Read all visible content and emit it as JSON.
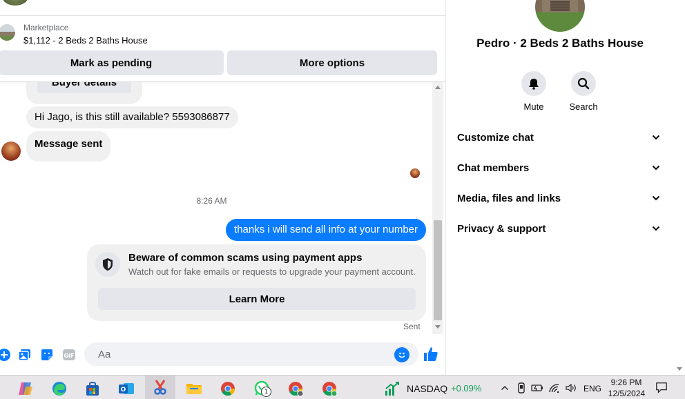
{
  "marketplace": {
    "label": "Marketplace",
    "listing": "$1,112 - 2 Beds 2 Baths House",
    "mark_pending": "Mark as pending",
    "more_options": "More options"
  },
  "messages": {
    "partial_button": "Buyer details",
    "incoming": [
      "Hi Jago, is this still available? 5593086877",
      "Message sent"
    ],
    "timestamp": "8:26 AM",
    "outgoing": "thanks i will send all info at your number",
    "scam_card": {
      "title": "Beware of common scams using payment apps",
      "subtitle": "Watch out for fake emails or requests to upgrade your payment account.",
      "button": "Learn More"
    },
    "status": "Sent"
  },
  "composer": {
    "placeholder": "Aa",
    "icons": [
      "plus-icon",
      "image-icon",
      "sticker-icon",
      "gif-icon",
      "emoji-icon",
      "like-icon"
    ]
  },
  "info": {
    "name": "Pedro · 2 Beds 2 Baths House",
    "actions": [
      {
        "label": "Mute",
        "icon": "bell-icon"
      },
      {
        "label": "Search",
        "icon": "search-icon"
      }
    ],
    "sections": [
      "Customize chat",
      "Chat members",
      "Media, files and links",
      "Privacy & support"
    ]
  },
  "taskbar": {
    "nasdaq": "NASDAQ",
    "nasdaq_change": "+0.09%",
    "whatsapp_badge": "1",
    "language": "ENG",
    "time": "9:26 PM",
    "date": "12/5/2024"
  },
  "colors": {
    "accent": "#0a7cff",
    "bubble_in": "#f0f0f0",
    "button_bg": "#e4e6eb",
    "positive": "#0f9d58"
  }
}
